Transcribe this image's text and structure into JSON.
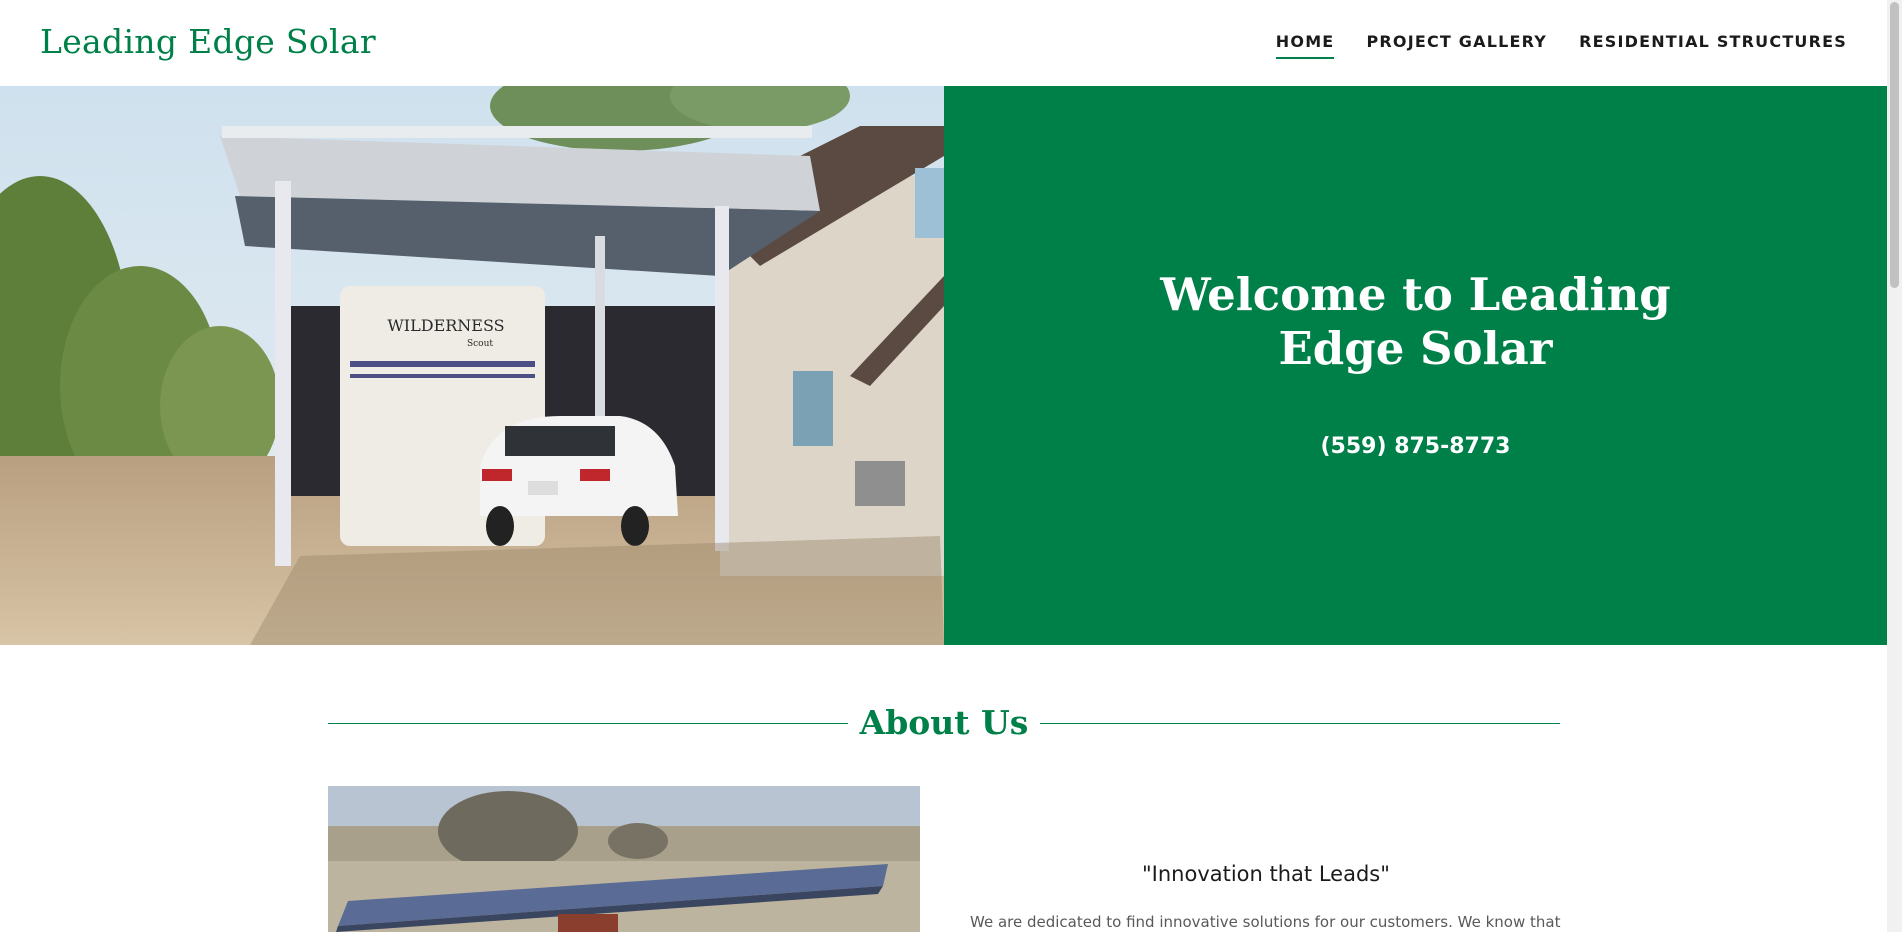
{
  "site": {
    "logo": "Leading Edge Solar"
  },
  "nav": {
    "items": [
      {
        "label": "HOME",
        "active": true
      },
      {
        "label": "PROJECT GALLERY",
        "active": false
      },
      {
        "label": "RESIDENTIAL STRUCTURES",
        "active": false
      }
    ]
  },
  "hero": {
    "title": "Welcome to Leading Edge Solar",
    "phone": "(559) 875-8773",
    "photo_text": "WILDERNESS",
    "photo_subtext": "Scout"
  },
  "about": {
    "heading": "About Us",
    "tagline": "\"Innovation that Leads\"",
    "body": "We are dedicated to find innovative solutions for our customers. We know that"
  },
  "colors": {
    "brand_green": "#008049",
    "text_dark": "#1b1b1b",
    "text_muted": "#595959"
  }
}
